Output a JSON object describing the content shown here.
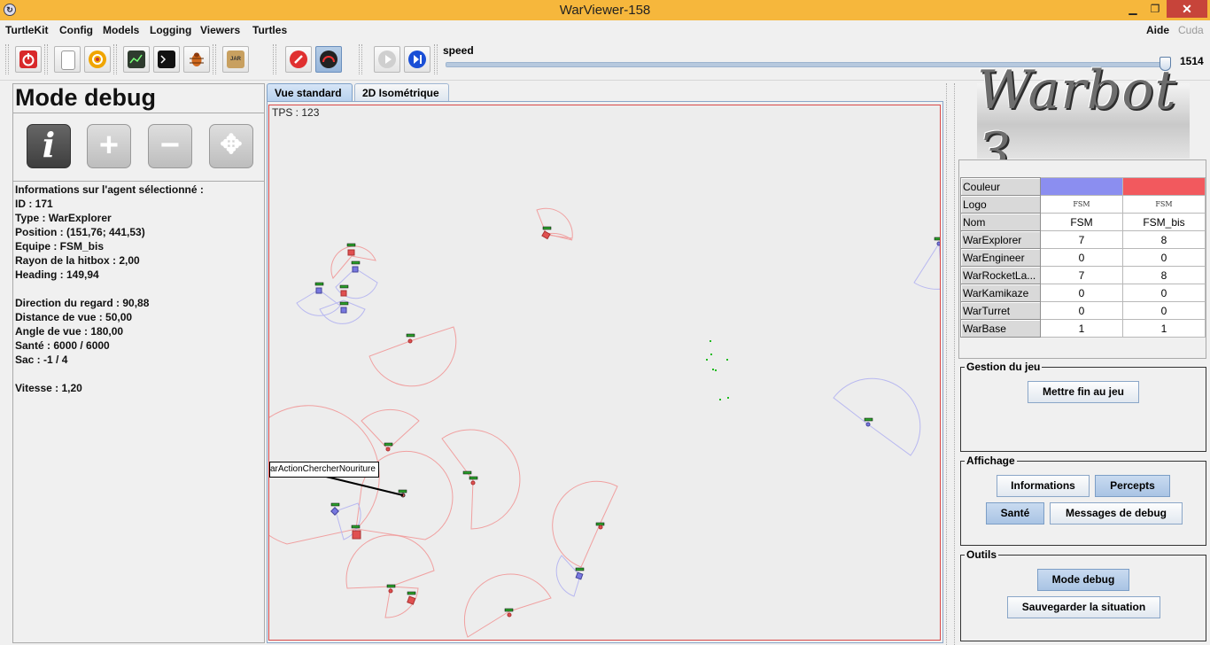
{
  "window": {
    "title": "WarViewer-158",
    "app_icon_glyph": "↻"
  },
  "menubar": {
    "items": [
      "TurtleKit",
      "Config",
      "Models",
      "Logging",
      "Viewers",
      "Turtles"
    ],
    "help": "Aide",
    "cuda": "Cuda"
  },
  "toolbar": {
    "speed_label": "speed",
    "speed_value": "1514",
    "speed_fraction": 0.995
  },
  "left_panel": {
    "title": "Mode debug",
    "tools": [
      {
        "name": "info-tool-icon",
        "glyph": "i"
      },
      {
        "name": "add-tool-icon",
        "glyph": "+"
      },
      {
        "name": "remove-tool-icon",
        "glyph": "−"
      },
      {
        "name": "move-tool-icon",
        "glyph": "✥"
      }
    ],
    "info_lines": [
      "Informations sur l'agent sélectionné :",
      "ID : 171",
      "Type : WarExplorer",
      "Position : (151,76; 441,53)",
      "Equipe : FSM_bis",
      "Rayon de la hitbox : 2,00",
      "Heading : 149,94",
      "",
      "Direction du regard : 90,88",
      "Distance de vue : 50,00",
      "Angle de vue : 180,00",
      "Santé : 6000 / 6000",
      "Sac : -1 / 4",
      "",
      "Vitesse : 1,20"
    ]
  },
  "tabs": [
    "Vue standard",
    "2D Isométrique"
  ],
  "map": {
    "tps": "TPS : 123",
    "agent_label": "arActionChercherNouriture",
    "colors": {
      "red_team": "#e05050",
      "blue_team": "#7878e0",
      "food": "#22bb22",
      "health": "#22aa22"
    }
  },
  "logo_text": "Warbot 3",
  "teams_table": {
    "rows": [
      {
        "label": "Couleur",
        "a": "",
        "b": "",
        "type": "color"
      },
      {
        "label": "Logo",
        "a": "FSM",
        "b": "FSM",
        "type": "logo"
      },
      {
        "label": "Nom",
        "a": "FSM",
        "b": "FSM_bis"
      },
      {
        "label": "WarExplorer",
        "a": "7",
        "b": "8"
      },
      {
        "label": "WarEngineer",
        "a": "0",
        "b": "0"
      },
      {
        "label": "WarRocketLa...",
        "a": "7",
        "b": "8"
      },
      {
        "label": "WarKamikaze",
        "a": "0",
        "b": "0"
      },
      {
        "label": "WarTurret",
        "a": "0",
        "b": "0"
      },
      {
        "label": "WarBase",
        "a": "1",
        "b": "1"
      }
    ],
    "team_colors": [
      "#8b8ef0",
      "#f2595e"
    ]
  },
  "game_group": {
    "title": "Gestion du jeu",
    "end_button": "Mettre fin au jeu"
  },
  "display_group": {
    "title": "Affichage",
    "informations": "Informations",
    "percepts": "Percepts",
    "sante": "Santé",
    "messages": "Messages de debug"
  },
  "tools_group": {
    "title": "Outils",
    "debug_mode": "Mode debug",
    "save": "Sauvegarder la situation"
  }
}
